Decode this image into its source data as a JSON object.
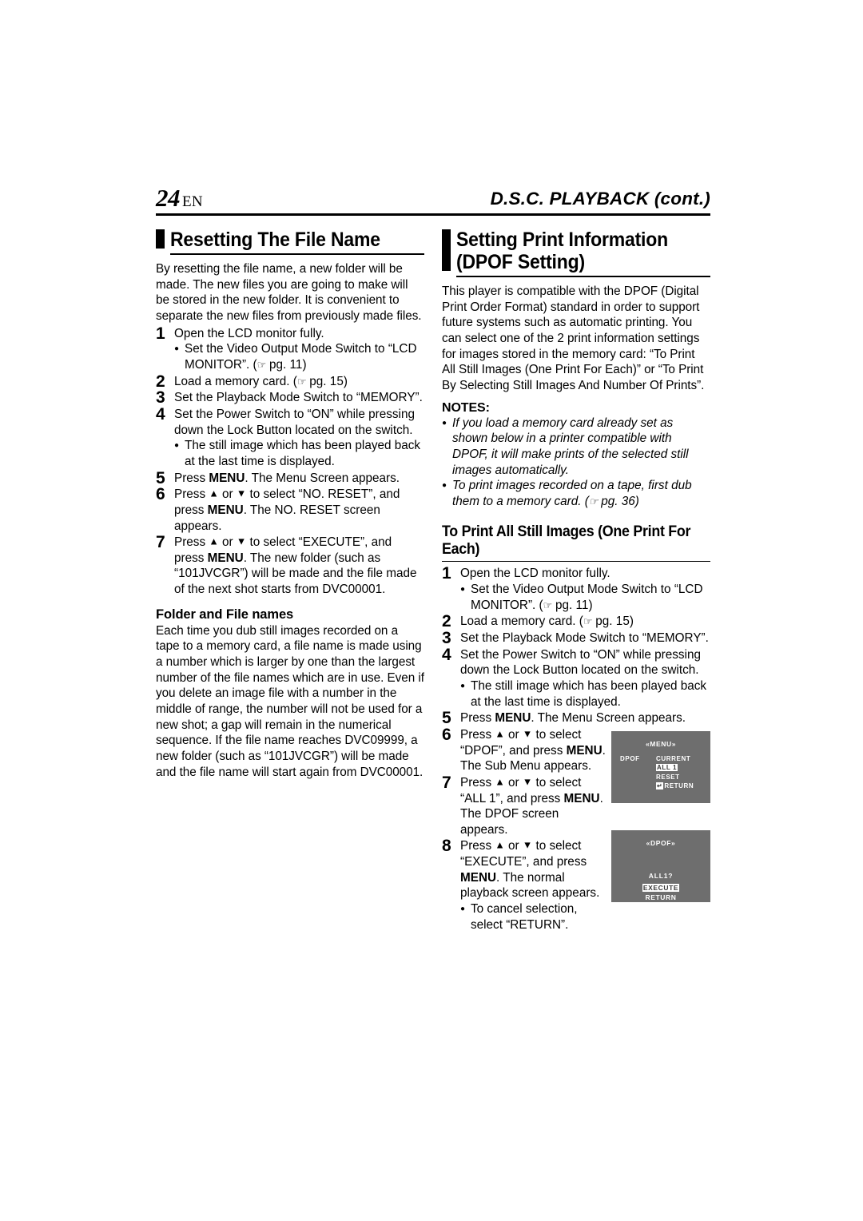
{
  "header": {
    "page_number": "24",
    "language_code": "EN",
    "chapter_title": "D.S.C. PLAYBACK (cont.)"
  },
  "left_column": {
    "section_title": "Resetting The File Name",
    "intro": "By resetting the file name, a new folder will be made. The new files you are going to make will be stored in the new folder. It is convenient to separate the new files from previously made files.",
    "steps": [
      {
        "num": "1",
        "text": "Open the LCD monitor fully.",
        "subs": [
          "Set the Video Output Mode Switch to “LCD MONITOR”. (☞ pg. 11)"
        ]
      },
      {
        "num": "2",
        "text": "Load a memory card. (☞ pg. 15)",
        "subs": []
      },
      {
        "num": "3",
        "text": "Set the Playback Mode Switch to “MEMORY”.",
        "subs": []
      },
      {
        "num": "4",
        "text": "Set the Power Switch to “ON” while pressing down the Lock Button located on the switch.",
        "subs": [
          "The still image which has been played back at the last time is displayed."
        ]
      },
      {
        "num": "5",
        "text": "Press MENU. The Menu Screen appears.",
        "subs": []
      },
      {
        "num": "6",
        "text": "Press ▲ or ▼ to select “NO. RESET”, and press MENU. The NO. RESET screen appears.",
        "subs": []
      },
      {
        "num": "7",
        "text": "Press ▲ or ▼ to select “EXECUTE”, and press MENU. The new folder (such as “101JVCGR”) will be made and the file made of the next shot starts from DVC00001.",
        "subs": []
      }
    ],
    "subheading": "Folder and File names",
    "subheading_body": "Each time you dub still images recorded on a tape to a memory card, a file name is made using a number which is larger by one than the largest number of the file names which are in use. Even if you delete an image file with a number in the middle of range, the number will not be used for a new shot; a gap will remain in the numerical sequence. If the file name reaches DVC09999, a new folder (such as “101JVCGR”) will be made and the file name will start again from DVC00001."
  },
  "right_column": {
    "section_title": "Setting Print Information (DPOF Setting)",
    "intro": "This player is compatible with the DPOF (Digital Print Order Format) standard in order to support future systems such as automatic printing. You can select one of the 2 print information settings for images stored in the memory card: “To Print All Still Images (One Print For Each)” or “To Print By Selecting Still Images And Number Of Prints”.",
    "notes_label": "NOTES:",
    "notes": [
      "If you load a memory card already set as shown below in a printer compatible with DPOF, it will make prints of the selected still images automatically.",
      "To print images recorded on a tape, first dub them to a memory card. (☞ pg. 36)"
    ],
    "subheading": "To Print All Still Images (One Print For Each)",
    "steps": [
      {
        "num": "1",
        "text": "Open the LCD monitor fully.",
        "subs": [
          "Set the Video Output Mode Switch to “LCD MONITOR”. (☞ pg. 11)"
        ]
      },
      {
        "num": "2",
        "text": "Load a memory card. (☞ pg. 15)",
        "subs": []
      },
      {
        "num": "3",
        "text": "Set the Playback Mode Switch to “MEMORY”.",
        "subs": []
      },
      {
        "num": "4",
        "text": "Set the Power Switch to “ON” while pressing down the Lock Button located on the switch.",
        "subs": [
          "The still image which has been played back at the last time is displayed."
        ]
      },
      {
        "num": "5",
        "text": "Press MENU. The Menu Screen appears.",
        "subs": []
      }
    ],
    "steps_with_screens": [
      {
        "num": "6",
        "text": "Press ▲ or ▼ to select “DPOF”, and press MENU. The Sub Menu appears.",
        "subs": []
      },
      {
        "num": "7",
        "text": "Press ▲ or ▼ to select “ALL 1”, and press MENU. The DPOF screen appears.",
        "subs": []
      },
      {
        "num": "8",
        "text": "Press ▲ or ▼ to select “EXECUTE”, and press MENU. The normal playback screen appears.",
        "subs": [
          "To cancel selection, select “RETURN”."
        ]
      }
    ],
    "screens": [
      {
        "title": "«MENU»",
        "left_label": "DPOF",
        "options": [
          "CURRENT",
          "ALL  1",
          "RESET",
          "RETURN"
        ],
        "selected": "ALL  1",
        "return_symbol": "↵",
        "background_color": "#6e6e6e"
      },
      {
        "title": "«DPOF»",
        "question": "ALL1?",
        "options": [
          "EXECUTE",
          "RETURN"
        ],
        "selected": "EXECUTE",
        "background_color": "#6e6e6e"
      }
    ]
  }
}
